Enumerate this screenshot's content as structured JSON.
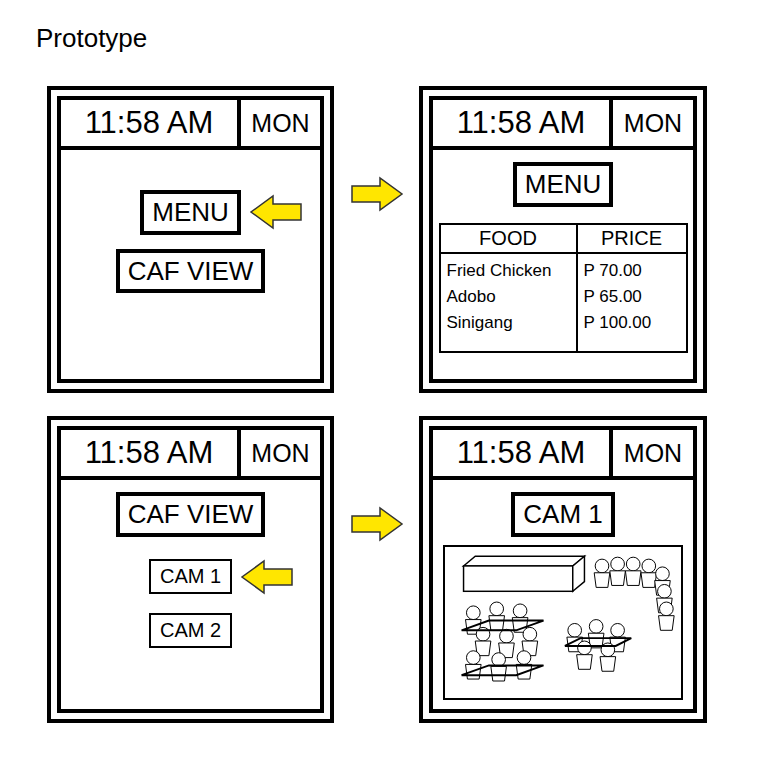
{
  "title": "Prototype",
  "rows": [
    {
      "screens": [
        {
          "kind": "options",
          "time": "11:58 AM",
          "day": "MON",
          "heading": "",
          "buttons": [
            {
              "label": "MENU",
              "selected": true
            },
            {
              "label": "CAF VIEW",
              "selected": false
            }
          ]
        },
        {
          "kind": "table",
          "time": "11:58 AM",
          "day": "MON",
          "heading": "MENU",
          "columns": [
            "FOOD",
            "PRICE"
          ],
          "items": [
            {
              "food": "Fried Chicken",
              "price": "P 70.00"
            },
            {
              "food": "Adobo",
              "price": "P 65.00"
            },
            {
              "food": "Sinigang",
              "price": "P 100.00"
            }
          ]
        }
      ]
    },
    {
      "screens": [
        {
          "kind": "options",
          "time": "11:58 AM",
          "day": "MON",
          "heading": "CAF VIEW",
          "buttons": [
            {
              "label": "CAM 1",
              "selected": true
            },
            {
              "label": "CAM 2",
              "selected": false
            }
          ]
        },
        {
          "kind": "camera",
          "time": "11:58 AM",
          "day": "MON",
          "heading": "CAM 1"
        }
      ]
    }
  ]
}
